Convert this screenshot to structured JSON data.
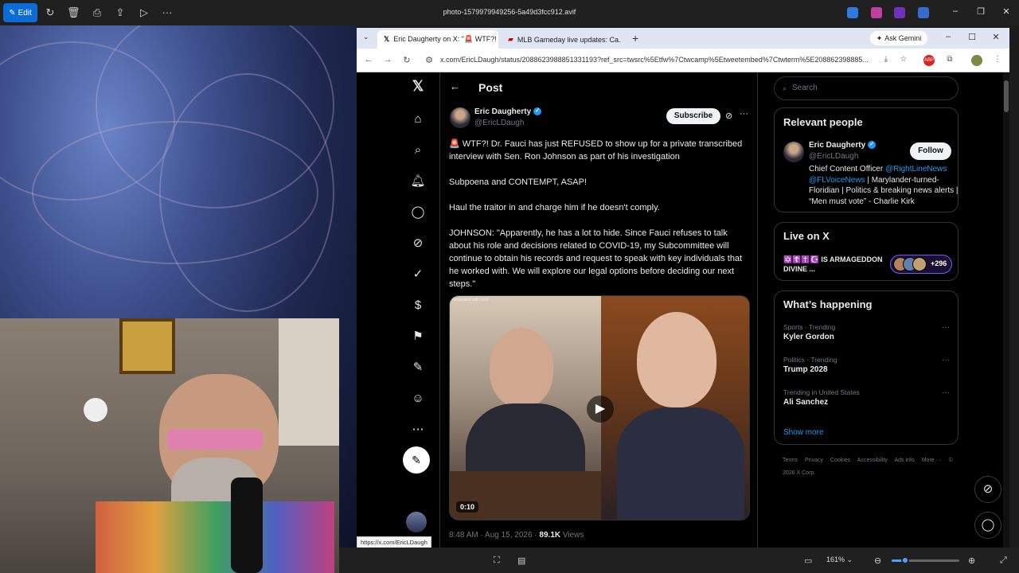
{
  "viewer": {
    "edit_label": "Edit",
    "title": "photo-1579979949256-5a49d3fcc912.avif",
    "zoom": "161%",
    "zoom_fraction": 0.2
  },
  "browser": {
    "tabs": [
      {
        "label": "Eric Daugherty on X: \"🚨 WTF?!",
        "active": true
      },
      {
        "label": "MLB Gameday live updates: Ca...",
        "active": false
      }
    ],
    "ask_gemini": "Ask Gemini",
    "url": "x.com/EricLDaugh/status/2088623988851331193?ref_src=twsrc%5Etfw%7Ctwcamp%5Etweetembed%7Ctwterm%5E208862398885...",
    "status_url": "https://x.com/EricLDaugh"
  },
  "post": {
    "header": "Post",
    "author_name": "Eric Daugherty",
    "author_handle": "@EricLDaugh",
    "subscribe": "Subscribe",
    "paragraphs": [
      "🚨 WTF?! Dr. Fauci has just REFUSED to show up for a private transcribed interview with Sen. Ron Johnson as part of his investigation",
      "Subpoena and CONTEMPT, ASAP!",
      "Haul the traitor in and charge him if he doesn't comply.",
      "JOHNSON: \"Apparently, he has a lot to hide. Since Fauci refuses to talk about his role and decisions related to COVID-19, my Subcommittee will continue to obtain his records and request to speak with key individuals that he worked with. We will explore our legal options before deciding our next steps.\""
    ],
    "media_tag": "Generated with Grok",
    "video_duration": "0:10",
    "timestamp": "8:48 AM · Aug 15, 2026 · ",
    "views_count": "89.1K",
    "views_label": " Views"
  },
  "sidebar": {
    "search_placeholder": "Search",
    "relevant_title": "Relevant people",
    "rp_name": "Eric Daugherty",
    "rp_handle": "@EricLDaugh",
    "follow": "Follow",
    "rp_bio_1": "Chief Content Officer ",
    "rp_bio_link1": "@RightLineNews",
    "rp_bio_link2": "@FLVoiceNews",
    "rp_bio_2": " | Marylander-turned-Floridian | Politics & breaking news alerts | “Men must vote” - Charlie Kirk",
    "live_title_label": "Live on X",
    "live_title": "✡️☦️✝️☪️ IS ARMAGEDDON DIVINE ...",
    "live_count": "+296",
    "happening_title": "What’s happening",
    "trends": [
      {
        "category": "Sports · Trending",
        "name": "Kyler Gordon"
      },
      {
        "category": "Politics · Trending",
        "name": "Trump 2028"
      },
      {
        "category": "Trending in United States",
        "name": "Ali Sanchez"
      }
    ],
    "show_more": "Show more",
    "footer": [
      "Terms",
      "Privacy",
      "Cookies",
      "Accessibility",
      "Ads info",
      "More ···",
      "© 2026 X Corp."
    ]
  }
}
